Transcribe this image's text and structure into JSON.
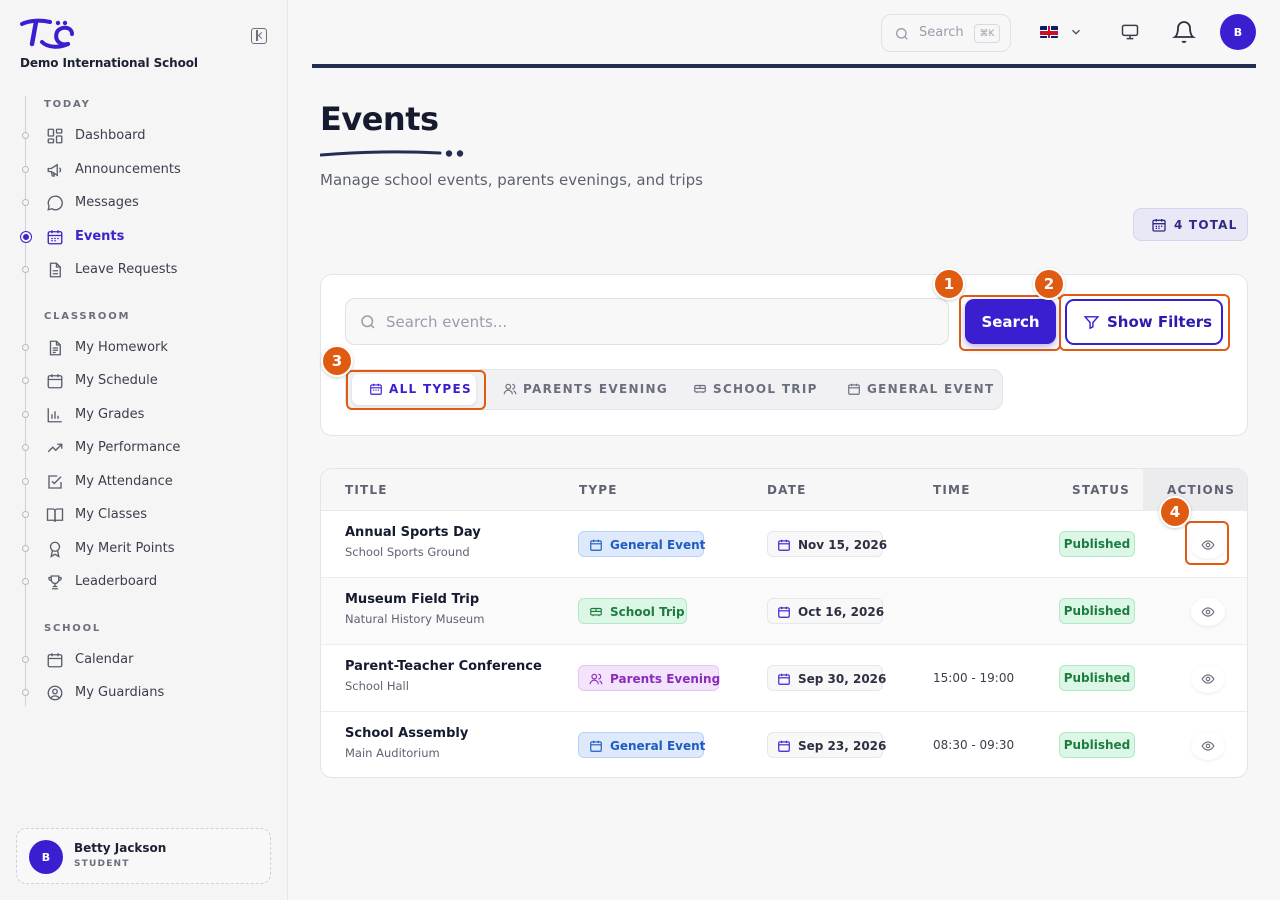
{
  "brand": {
    "name": "Demo International School",
    "logo": "TE"
  },
  "sidebar": {
    "sections": [
      {
        "label": "TODAY",
        "items": [
          {
            "label": "Dashboard",
            "icon": "dashboard-icon"
          },
          {
            "label": "Announcements",
            "icon": "megaphone-icon"
          },
          {
            "label": "Messages",
            "icon": "chat-bubble-icon"
          },
          {
            "label": "Events",
            "icon": "calendar-icon",
            "active": true
          },
          {
            "label": "Leave Requests",
            "icon": "document-icon"
          }
        ]
      },
      {
        "label": "CLASSROOM",
        "items": [
          {
            "label": "My Homework",
            "icon": "homework-icon"
          },
          {
            "label": "My Schedule",
            "icon": "calendar-icon"
          },
          {
            "label": "My Grades",
            "icon": "bar-chart-icon"
          },
          {
            "label": "My Performance",
            "icon": "trend-up-icon"
          },
          {
            "label": "My Attendance",
            "icon": "checkbox-icon"
          },
          {
            "label": "My Classes",
            "icon": "book-icon"
          },
          {
            "label": "My Merit Points",
            "icon": "award-icon"
          },
          {
            "label": "Leaderboard",
            "icon": "trophy-icon"
          }
        ]
      },
      {
        "label": "SCHOOL",
        "items": [
          {
            "label": "Calendar",
            "icon": "calendar-icon"
          },
          {
            "label": "My Guardians",
            "icon": "user-circle-icon"
          }
        ]
      }
    ]
  },
  "user": {
    "initial": "B",
    "name": "Betty Jackson",
    "role": "STUDENT"
  },
  "topbar": {
    "search_placeholder": "Search",
    "shortcut": "⌘K",
    "language": "en-GB",
    "avatar_initial": "B"
  },
  "page": {
    "title": "Events",
    "subtitle": "Manage school events, parents evenings, and trips",
    "total_badge": "4 TOTAL"
  },
  "filters": {
    "search_placeholder": "Search events...",
    "search_button": "Search",
    "filters_button": "Show Filters",
    "types": [
      {
        "label": "ALL TYPES",
        "active": true
      },
      {
        "label": "PARENTS EVENING"
      },
      {
        "label": "SCHOOL TRIP"
      },
      {
        "label": "GENERAL EVENT"
      }
    ]
  },
  "table": {
    "headers": {
      "title": "TITLE",
      "type": "TYPE",
      "date": "DATE",
      "time": "TIME",
      "status": "STATUS",
      "actions": "ACTIONS"
    },
    "rows": [
      {
        "title": "Annual Sports Day",
        "location": "School Sports Ground",
        "type": "General Event",
        "date": "Nov 15, 2026",
        "time": "",
        "status": "Published"
      },
      {
        "title": "Museum Field Trip",
        "location": "Natural History Museum",
        "type": "School Trip",
        "date": "Oct 16, 2026",
        "time": "",
        "status": "Published"
      },
      {
        "title": "Parent-Teacher Conference",
        "location": "School Hall",
        "type": "Parents Evening",
        "date": "Sep 30, 2026",
        "time": "15:00 - 19:00",
        "status": "Published"
      },
      {
        "title": "School Assembly",
        "location": "Main Auditorium",
        "type": "General Event",
        "date": "Sep 23, 2026",
        "time": "08:30 - 09:30",
        "status": "Published"
      }
    ]
  },
  "annotations": {
    "markers": [
      "1",
      "2",
      "3",
      "4"
    ],
    "color": "#e05b12"
  },
  "colors": {
    "accent": "#3a1fd1",
    "annotation": "#e05b12",
    "published": "#1e7c42"
  }
}
